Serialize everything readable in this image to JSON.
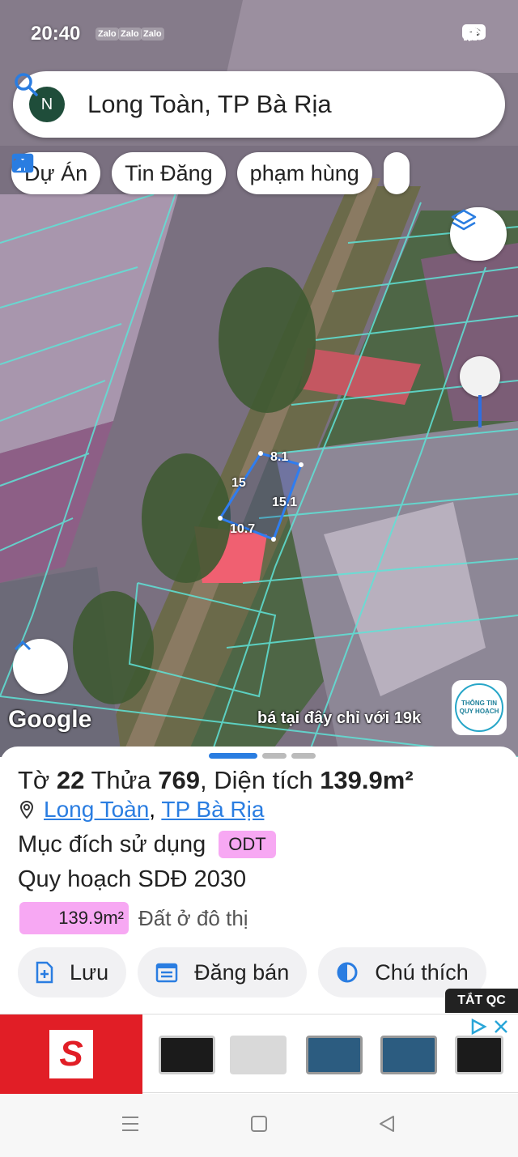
{
  "status_bar": {
    "time": "20:40",
    "notif_1": "Zalo",
    "notif_2": "Zalo",
    "notif_3": "Zalo",
    "battery": "99"
  },
  "search": {
    "avatar_letter": "N",
    "query": "Long Toàn, TP Bà Rịa"
  },
  "chips": [
    {
      "label": "Dự Án",
      "icon": "home-city-icon"
    },
    {
      "label": "Tin Đăng",
      "icon": "calendar-list-icon"
    },
    {
      "label": "phạm hùng",
      "icon": "ruler-crossed-icon"
    }
  ],
  "map": {
    "dimensions": {
      "top": "8.1",
      "left": "15",
      "right": "15.1",
      "bottom": "10.7"
    },
    "google_label": "Google",
    "promo_text": "bá tại đây chỉ với 19k",
    "planning_badge": "THÔNG TIN QUY HOẠCH"
  },
  "parcel": {
    "sheet_label": "Tờ",
    "sheet_number": "22",
    "plot_label": "Thửa",
    "plot_number": "769",
    "area_label": "Diện tích",
    "area_value": "139.9m²",
    "location_ward": "Long Toàn",
    "location_city": "TP Bà Rịa",
    "purpose_label": "Mục đích sử dụng",
    "purpose_code": "ODT",
    "plan_label": "Quy hoạch SDĐ 2030",
    "plan_area": "139.9m²",
    "plan_type": "Đất ở đô thị"
  },
  "actions": [
    {
      "label": "Lưu",
      "icon": "file-plus-icon"
    },
    {
      "label": "Đăng bán",
      "icon": "calendar-list-icon"
    },
    {
      "label": "Chú thích",
      "icon": "half-circle-icon"
    }
  ],
  "ad": {
    "hide_label": "TẮT QC",
    "brand_letter": "S"
  },
  "colors": {
    "accent": "#2a7de1",
    "purpose_badge": "#f7a8f3",
    "parcel_outline": "#2f7df0",
    "plot_lines": "#5fe3d7"
  }
}
